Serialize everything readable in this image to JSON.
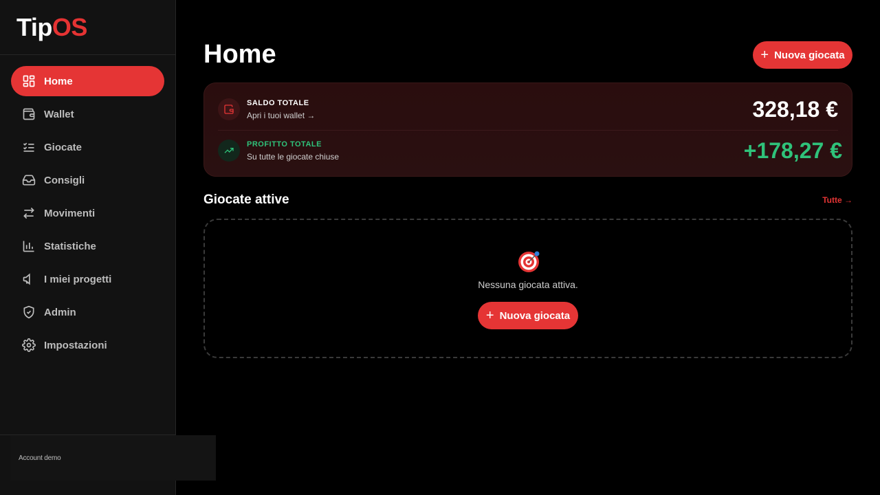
{
  "brand": {
    "part1": "Tip",
    "part2": "OS"
  },
  "sidebar": {
    "items": [
      {
        "label": "Home",
        "icon": "dashboard-icon"
      },
      {
        "label": "Wallet",
        "icon": "wallet-icon"
      },
      {
        "label": "Giocate",
        "icon": "checklist-icon"
      },
      {
        "label": "Consigli",
        "icon": "inbox-icon"
      },
      {
        "label": "Movimenti",
        "icon": "swap-icon"
      },
      {
        "label": "Statistiche",
        "icon": "bar-chart-icon"
      },
      {
        "label": "I miei progetti",
        "icon": "megaphone-icon"
      },
      {
        "label": "Admin",
        "icon": "shield-check-icon"
      },
      {
        "label": "Impostazioni",
        "icon": "gear-icon"
      }
    ],
    "account": "Account demo"
  },
  "page": {
    "title": "Home",
    "new_bet_label": "Nuova giocata"
  },
  "summary": {
    "balance": {
      "label": "SALDO TOTALE",
      "sub": "Apri i tuoi wallet →",
      "amount": "328,18 €"
    },
    "profit": {
      "label": "PROFITTO TOTALE",
      "sub": "Su tutte le giocate chiuse",
      "amount": "+178,27 €"
    }
  },
  "active": {
    "title": "Giocate attive",
    "link": "Tutte →",
    "empty_text": "Nessuna giocata attiva.",
    "button_label": "Nuova giocata"
  },
  "colors": {
    "accent": "#e53535",
    "positive": "#2fc27a",
    "background": "#000000",
    "sidebar": "#121212"
  }
}
